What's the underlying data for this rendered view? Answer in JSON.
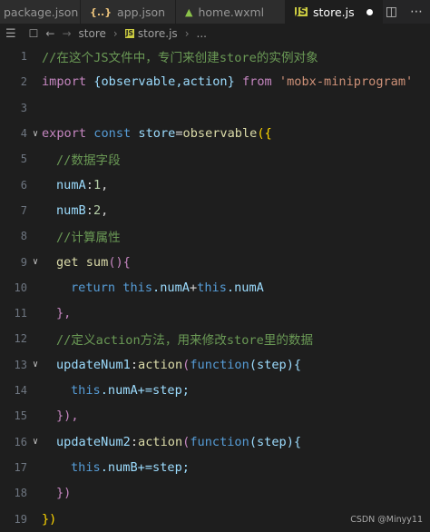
{
  "tabs": [
    {
      "label": "package.json"
    },
    {
      "label": "app.json",
      "icon": "{..}"
    },
    {
      "label": "home.wxml"
    },
    {
      "label": "store.js",
      "icon": "JS"
    }
  ],
  "breadcrumb": {
    "folder": "store",
    "file": "store.js",
    "ellipsis": "..."
  },
  "code": {
    "line_numbers": [
      "1",
      "2",
      "3",
      "4",
      "5",
      "6",
      "7",
      "8",
      "9",
      "10",
      "11",
      "12",
      "13",
      "14",
      "15",
      "16",
      "17",
      "18",
      "19"
    ],
    "l1": "//在这个JS文件中，专门来创建store的实例对象",
    "l2_import": "import",
    "l2_brace": " {observable,action} ",
    "l2_from": "from",
    "l2_str": "'mobx-miniprogram'",
    "l4_export": "export",
    "l4_const": "const",
    "l4_store": "store",
    "l4_eq": "=",
    "l4_obs": "observable",
    "l4_paren": "({",
    "l5": "//数据字段",
    "l6_key": "numA",
    "l6_val": "1",
    "l7_key": "numB",
    "l7_val": "2",
    "l8": "//计算属性",
    "l9_get": "get",
    "l9_sum": "sum",
    "l9_rest": "(){",
    "l10_return": "return",
    "l10_this1": "this",
    "l10_numA": ".numA",
    "l10_plus": "+",
    "l10_this2": "this",
    "l10_numA2": ".numA",
    "l11": "},",
    "l12_a": "//定义",
    "l12_b": "action",
    "l12_c": "方法，用来修改",
    "l12_d": "store",
    "l12_e": "里的数据",
    "l13_name": "updateNum1",
    "l13_colon": ":",
    "l13_action": "action",
    "l13_p": "(",
    "l13_fn": "function",
    "l13_step": "(step){",
    "l14_this": "this",
    "l14_rest": ".numA+=step;",
    "l15": "}),",
    "l16_name": "updateNum2",
    "l16_colon": ":",
    "l16_action": "action",
    "l16_p": "(",
    "l16_fn": "function",
    "l16_step": "(step){",
    "l17_this": "this",
    "l17_rest": ".numB+=step;",
    "l18": "})",
    "l19": "})"
  },
  "watermark": "CSDN @Minyy11"
}
